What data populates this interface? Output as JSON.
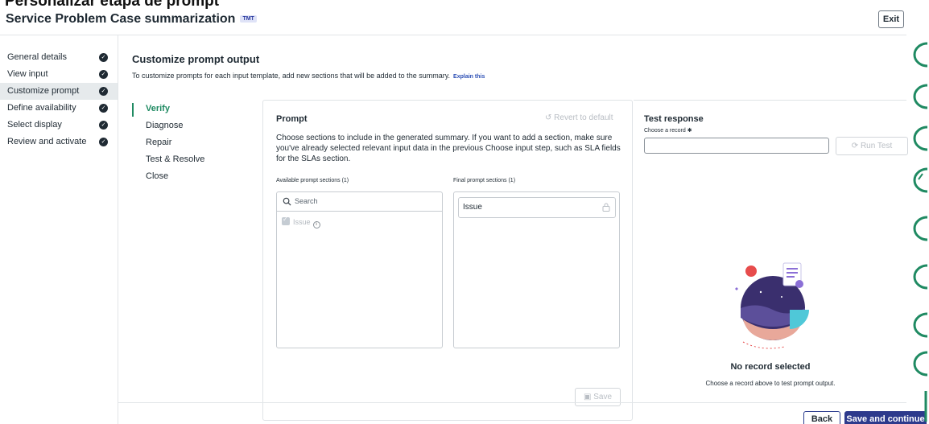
{
  "header": {
    "top_cut_text": "Personalizar etapa de prompt",
    "app_title": "Service Problem Case summarization",
    "badge": "TMT",
    "exit_label": "Exit"
  },
  "sidebar": {
    "items": [
      {
        "label": "General details",
        "done": true,
        "active": false
      },
      {
        "label": "View input",
        "done": true,
        "active": false
      },
      {
        "label": "Customize prompt",
        "done": true,
        "active": true
      },
      {
        "label": "Define availability",
        "done": true,
        "active": false
      },
      {
        "label": "Select display",
        "done": true,
        "active": false
      },
      {
        "label": "Review and activate",
        "done": true,
        "active": false
      }
    ]
  },
  "main": {
    "title": "Customize prompt output",
    "description": "To customize prompts for each input template, add new sections that will be added to the summary.",
    "explain_link": "Explain this",
    "steps": [
      {
        "label": "Verify",
        "active": true
      },
      {
        "label": "Diagnose",
        "active": false
      },
      {
        "label": "Repair",
        "active": false
      },
      {
        "label": "Test & Resolve",
        "active": false
      },
      {
        "label": "Close",
        "active": false
      }
    ]
  },
  "prompt": {
    "title": "Prompt",
    "revert_label": "Revert to default",
    "description": "Choose sections to include in the generated summary. If you want to add a section, make sure you've already selected relevant input data in the previous Choose input step, such as SLA fields for the SLAs section.",
    "available_label": "Available prompt sections (1)",
    "final_label": "Final prompt sections (1)",
    "search_placeholder": "Search",
    "available_items": [
      "Issue"
    ],
    "final_items": [
      "Issue"
    ],
    "save_label": "Save"
  },
  "test_response": {
    "title": "Test response",
    "choose_label": "Choose a record",
    "record_value": "",
    "run_label": "Run Test",
    "empty_title": "No record selected",
    "empty_sub": "Choose a record above to test prompt output."
  },
  "footer": {
    "back_label": "Back",
    "next_label": "Save and continue"
  },
  "colors": {
    "accent_green": "#1f8a62",
    "primary_button": "#2d3a8c",
    "active_sidebar_bg": "#e6eaec"
  }
}
